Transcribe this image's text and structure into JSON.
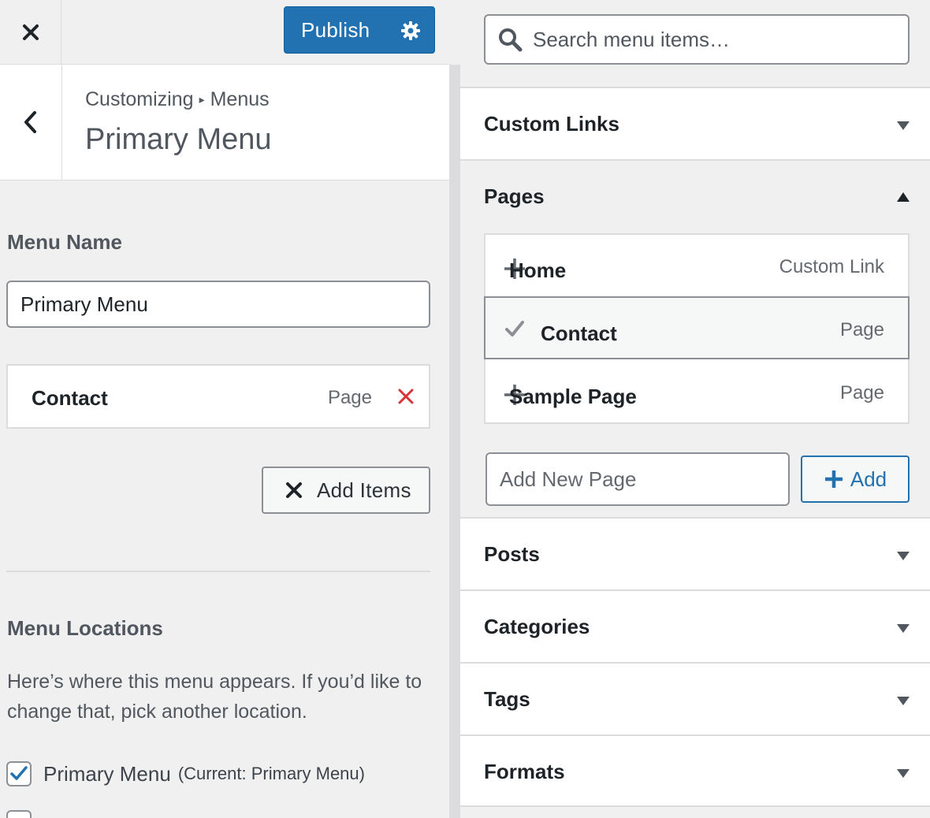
{
  "header": {
    "publish_label": "Publish"
  },
  "section": {
    "breadcrumb_parent": "Customizing",
    "breadcrumb_current": "Menus",
    "title": "Primary Menu"
  },
  "menu_name": {
    "label": "Menu Name",
    "value": "Primary Menu"
  },
  "menu_items": [
    {
      "title": "Contact",
      "type": "Page"
    }
  ],
  "add_items_label": "Add Items",
  "locations": {
    "heading": "Menu Locations",
    "description": "Here’s where this menu appears. If you’d like to change that, pick another location.",
    "items": [
      {
        "label": "Primary Menu",
        "current": "(Current: Primary Menu)",
        "checked": true
      }
    ]
  },
  "search": {
    "placeholder": "Search menu items…"
  },
  "accordion": {
    "custom_links": "Custom Links",
    "pages": "Pages",
    "posts": "Posts",
    "categories": "Categories",
    "tags": "Tags",
    "formats": "Formats"
  },
  "pages": [
    {
      "title": "Home",
      "type": "Custom Link",
      "added": false
    },
    {
      "title": "Contact",
      "type": "Page",
      "added": true
    },
    {
      "title": "Sample Page",
      "type": "Page",
      "added": false
    }
  ],
  "new_page": {
    "placeholder": "Add New Page",
    "button_label": "Add"
  },
  "colors": {
    "primary": "#2271b1",
    "remove": "#d63638",
    "checkmark": "#2271b1"
  },
  "icons": {
    "close": "close-icon",
    "settings": "gear-icon",
    "back": "chevron-left-icon",
    "remove": "remove-x-icon",
    "search": "search-icon",
    "add": "plus-icon",
    "added": "checkmark-icon"
  }
}
